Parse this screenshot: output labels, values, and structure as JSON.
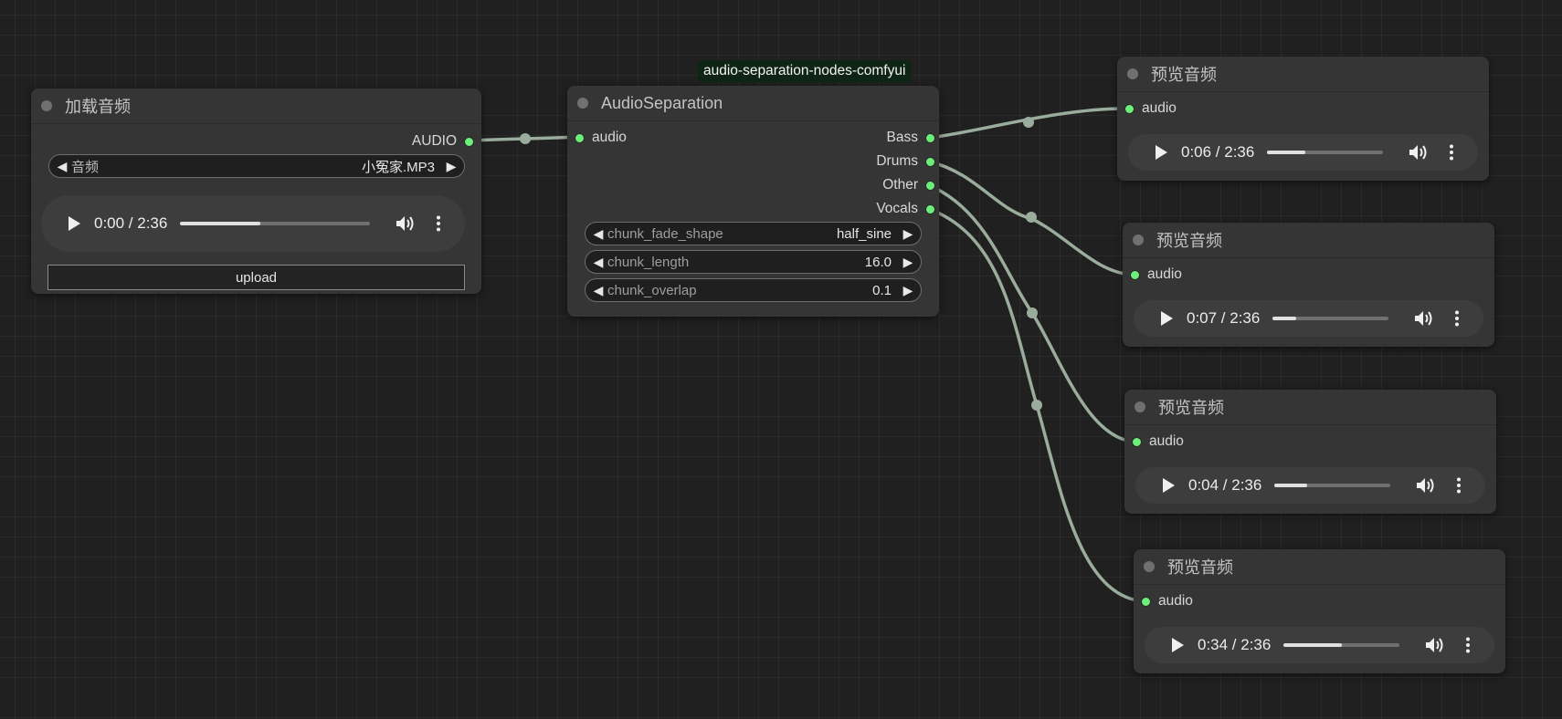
{
  "group_label": "audio-separation-nodes-comfyui",
  "load_node": {
    "title": "加载音频",
    "output_label": "AUDIO",
    "combo": {
      "name": "音频",
      "value": "小冤家.MP3"
    },
    "player": {
      "time": "0:00 / 2:36",
      "progress": 0.42
    },
    "upload_label": "upload"
  },
  "separation_node": {
    "title": "AudioSeparation",
    "input_label": "audio",
    "outputs": [
      "Bass",
      "Drums",
      "Other",
      "Vocals"
    ],
    "widgets": [
      {
        "name": "chunk_fade_shape",
        "value": "half_sine"
      },
      {
        "name": "chunk_length",
        "value": "16.0"
      },
      {
        "name": "chunk_overlap",
        "value": "0.1"
      }
    ]
  },
  "preview_nodes": [
    {
      "title": "预览音频",
      "input_label": "audio",
      "time": "0:06 / 2:36",
      "progress": 0.33
    },
    {
      "title": "预览音频",
      "input_label": "audio",
      "time": "0:07 / 2:36",
      "progress": 0.2
    },
    {
      "title": "预览音频",
      "input_label": "audio",
      "time": "0:04 / 2:36",
      "progress": 0.28
    },
    {
      "title": "预览音频",
      "input_label": "audio",
      "time": "0:34 / 2:36",
      "progress": 0.5
    }
  ],
  "colors": {
    "port": "#6cf07a",
    "link": "#9aac9c",
    "node_bg": "#353535",
    "canvas_bg": "#202020",
    "group_label_bg": "#0e2516"
  },
  "icons": {
    "play": "play-icon",
    "volume": "volume-icon",
    "more": "more-vert-icon",
    "left_arrow": "triangle-left-icon",
    "right_arrow": "triangle-right-icon"
  }
}
